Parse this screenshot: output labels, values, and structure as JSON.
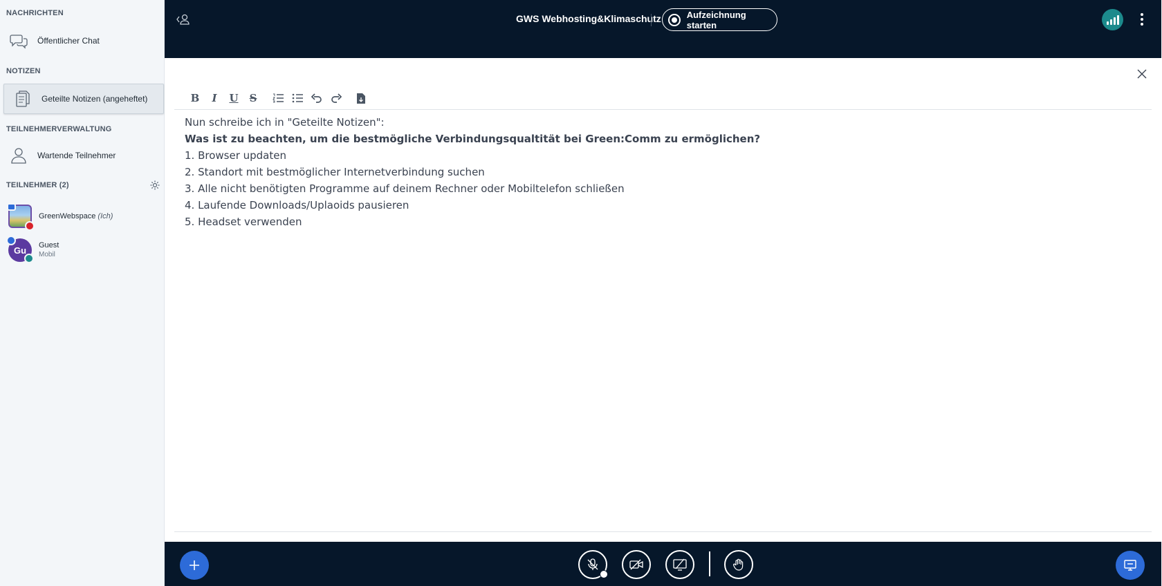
{
  "sidebar": {
    "messages_title": "NACHRICHTEN",
    "public_chat": "Öffentlicher Chat",
    "notes_title": "NOTIZEN",
    "shared_notes": "Geteilte Notizen (angeheftet)",
    "management_title": "TEILNEHMERVERWALTUNG",
    "waiting_users": "Wartende Teilnehmer",
    "participants_title": "TEILNEHMER (2)",
    "participants": [
      {
        "name": "GreenWebspace",
        "tag": "(Ich)",
        "sub": ""
      },
      {
        "name": "Guest",
        "tag": "",
        "sub": "Mobil",
        "initials": "Gu"
      }
    ]
  },
  "header": {
    "meeting_title": "GWS Webhosting&Klimaschutz",
    "record_label": "Aufzeichnung starten"
  },
  "notes": {
    "toolbar": [
      "bold-icon",
      "italic-icon",
      "underline-icon",
      "strikethrough-icon",
      "ordered-list-icon",
      "bullet-list-icon",
      "undo-icon",
      "redo-icon",
      "export-icon"
    ],
    "lines": [
      "Nun schreibe ich in \"Geteilte Notizen\":",
      "Was ist zu beachten, um die bestmögliche Verbindungsqualtität bei Green:Comm zu ermöglichen?",
      "1. Browser updaten",
      "2. Standort mit bestmöglicher Internetverbindung suchen",
      "3. Alle nicht benötigten Programme auf deinem Rechner oder Mobiltelefon schließen",
      "4. Laufende Downloads/Uplaoids pausieren",
      "5. Headset verwenden"
    ]
  },
  "colors": {
    "header_bg": "#06172a",
    "accent": "#2d6bd8",
    "connection": "#1c8a8c"
  }
}
